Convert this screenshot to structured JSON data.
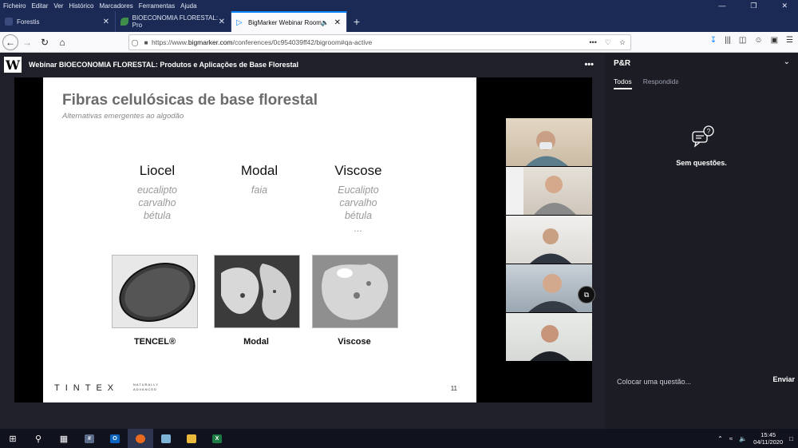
{
  "menubar": {
    "items": [
      "Ficheiro",
      "Editar",
      "Ver",
      "Histórico",
      "Marcadores",
      "Ferramentas",
      "Ajuda"
    ]
  },
  "tabs": [
    {
      "label": "Forestis",
      "active": false
    },
    {
      "label": "BIOECONOMIA FLORESTAL: Pro",
      "active": false
    },
    {
      "label": "BigMarker Webinar Room",
      "active": true
    }
  ],
  "url": {
    "prefix": "https://www.",
    "domain": "bigmarker.com",
    "path": "/conferences/0c954039ff42/bigroom#qa-active"
  },
  "app": {
    "logo": "W",
    "title": "Webinar BIOECONOMIA FLORESTAL: Produtos e Aplicações de Base Florestal",
    "menu": "•••"
  },
  "slide": {
    "title": "Fibras celulósicas de base florestal",
    "subtitle": "Alternativas emergentes ao algodão",
    "columns": [
      {
        "heading": "Liocel",
        "items": [
          "eucalipto",
          "carvalho",
          "bétula"
        ]
      },
      {
        "heading": "Modal",
        "items": [
          "faia"
        ]
      },
      {
        "heading": "Viscose",
        "items": [
          "Eucalipto",
          "carvalho",
          "bétula",
          "..."
        ]
      }
    ],
    "labels": [
      "TENCEL®",
      "Modal",
      "Viscose"
    ],
    "brand": "TINTEX",
    "brand_small": "NATURALLY ADVANCED",
    "page": "11"
  },
  "qa": {
    "title": "P&R",
    "tabs": [
      "Todos",
      "Respondidas"
    ],
    "empty": "Sem questões.",
    "placeholder": "Colocar uma questão...",
    "send": "Enviar"
  },
  "taskbar": {
    "time": "15:45",
    "date": "04/11/2020"
  },
  "colors": {
    "accent": "#0a84ff",
    "panel": "#1c1d24",
    "browser_chrome": "#1b2a55"
  }
}
